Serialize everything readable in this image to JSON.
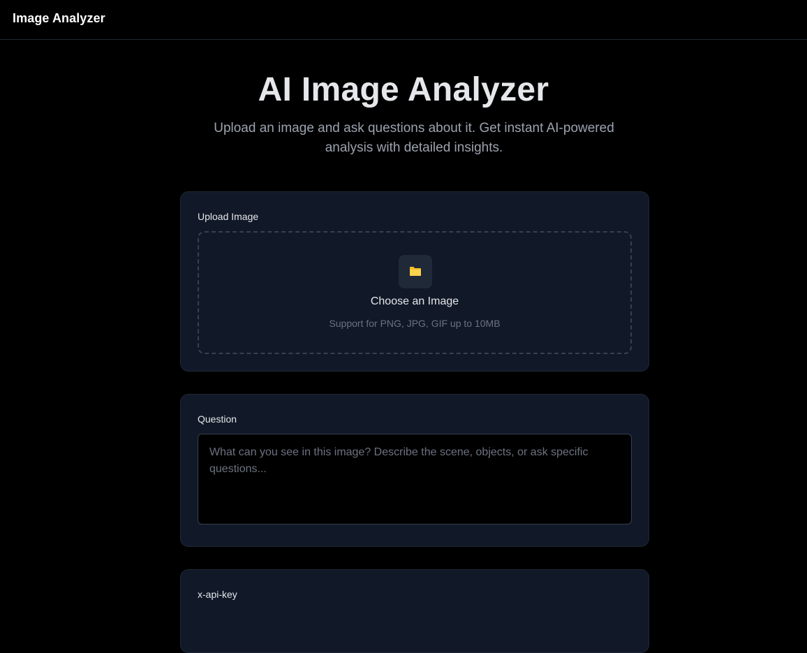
{
  "app": {
    "brand": "Image Analyzer"
  },
  "hero": {
    "title": "AI Image Analyzer",
    "subtitle": "Upload an image and ask questions about it. Get instant AI-powered analysis with detailed insights."
  },
  "upload": {
    "label": "Upload Image",
    "icon": "folder-icon",
    "title": "Choose an Image",
    "hint": "Support for PNG, JPG, GIF up to 10MB"
  },
  "question": {
    "label": "Question",
    "placeholder": "What can you see in this image? Describe the scene, objects, or ask specific questions...",
    "value": ""
  },
  "apikey": {
    "label": "x-api-key"
  },
  "colors": {
    "background": "#000000",
    "card": "#111827",
    "card_border": "#1f2937",
    "folder_icon": "#fbbf24",
    "muted_text": "#9ca3af"
  }
}
